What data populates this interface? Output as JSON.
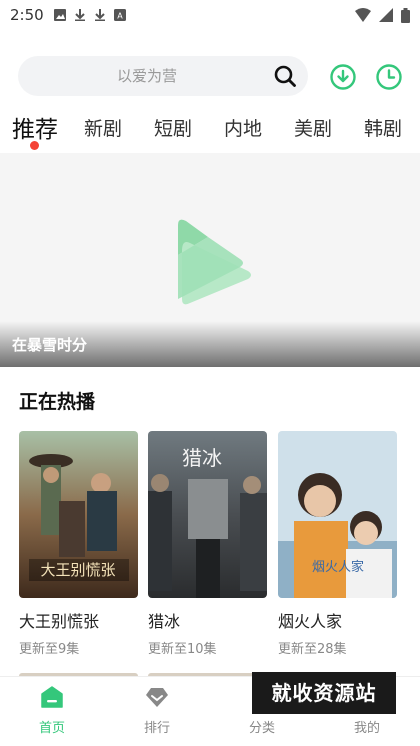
{
  "status_bar": {
    "time": "2:50"
  },
  "search": {
    "placeholder": "以爱为营"
  },
  "tabs": [
    {
      "label": "推荐",
      "active": true
    },
    {
      "label": "新剧",
      "active": false
    },
    {
      "label": "短剧",
      "active": false
    },
    {
      "label": "内地",
      "active": false
    },
    {
      "label": "美剧",
      "active": false
    },
    {
      "label": "韩剧",
      "active": false
    }
  ],
  "banner": {
    "title": "在暴雪时分",
    "logo_icon": "play-logo-icon"
  },
  "now_playing": {
    "heading": "正在热播",
    "items": [
      {
        "title": "大王别慌张",
        "subtitle": "更新至9集"
      },
      {
        "title": "猎冰",
        "subtitle": "更新至10集"
      },
      {
        "title": "烟火人家",
        "subtitle": "更新至28集"
      }
    ]
  },
  "bottom_nav": [
    {
      "label": "首页",
      "icon": "home-icon",
      "active": true
    },
    {
      "label": "排行",
      "icon": "ranking-icon",
      "active": false
    },
    {
      "label": "分类",
      "icon": "category-icon",
      "active": false
    },
    {
      "label": "我的",
      "icon": "profile-icon",
      "active": false
    }
  ],
  "watermark": "就收资源站",
  "colors": {
    "accent": "#34c77b",
    "tab_dot": "#f44336",
    "search_bg": "#f2f3f5"
  }
}
